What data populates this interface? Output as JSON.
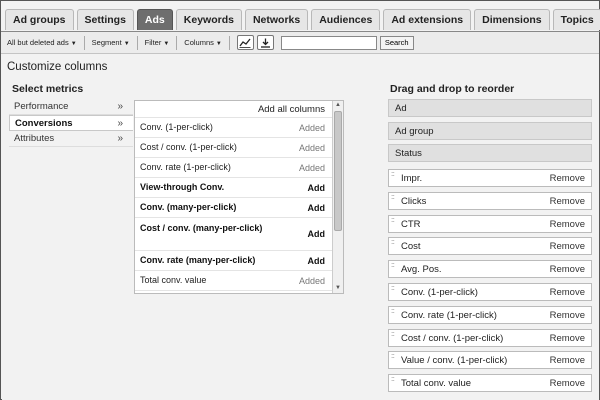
{
  "tabs": [
    {
      "label": "Ad groups",
      "active": false
    },
    {
      "label": "Settings",
      "active": false
    },
    {
      "label": "Ads",
      "active": true
    },
    {
      "label": "Keywords",
      "active": false
    },
    {
      "label": "Networks",
      "active": false
    },
    {
      "label": "Audiences",
      "active": false
    },
    {
      "label": "Ad extensions",
      "active": false
    },
    {
      "label": "Dimensions",
      "active": false
    },
    {
      "label": "Topics",
      "active": false
    }
  ],
  "toolbar": {
    "filter_status": "All but deleted ads",
    "segment": "Segment",
    "filter": "Filter",
    "columns": "Columns",
    "search_placeholder": "",
    "search_button": "Search"
  },
  "page_title": "Customize columns",
  "select_metrics": {
    "title": "Select metrics",
    "categories": [
      {
        "label": "Performance",
        "active": false
      },
      {
        "label": "Conversions",
        "active": true
      },
      {
        "label": "Attributes",
        "active": false
      }
    ],
    "add_all_label": "Add all columns",
    "metrics": [
      {
        "name": "Conv. (1-per-click)",
        "status": "Added"
      },
      {
        "name": "Cost / conv. (1-per-click)",
        "status": "Added"
      },
      {
        "name": "Conv. rate (1-per-click)",
        "status": "Added"
      },
      {
        "name": "View-through Conv.",
        "status": "Add"
      },
      {
        "name": "Conv. (many-per-click)",
        "status": "Add"
      },
      {
        "name": "Cost / conv. (many-per-click)",
        "status": "Add"
      },
      {
        "name": "Conv. rate (many-per-click)",
        "status": "Add"
      },
      {
        "name": "Total conv. value",
        "status": "Added"
      }
    ]
  },
  "reorder": {
    "title": "Drag and drop to reorder",
    "fixed_columns": [
      "Ad",
      "Ad group",
      "Status"
    ],
    "remove_label": "Remove",
    "columns": [
      "Impr.",
      "Clicks",
      "CTR",
      "Cost",
      "Avg. Pos.",
      "Conv. (1-per-click)",
      "Conv. rate (1-per-click)",
      "Cost / conv. (1-per-click)",
      "Value / conv. (1-per-click)",
      "Total conv. value"
    ]
  },
  "icons": {
    "tab_more": "chevron-down-icon",
    "chart": "line-chart-icon",
    "download": "download-icon",
    "category_arrow": "double-chevron-right-icon",
    "drag_handle": "drag-handle-icon"
  },
  "colors": {
    "active_tab": "#6e6e6e",
    "panel_bg": "#f2f2f2",
    "fixed_column_bg": "#e0e0e0"
  }
}
